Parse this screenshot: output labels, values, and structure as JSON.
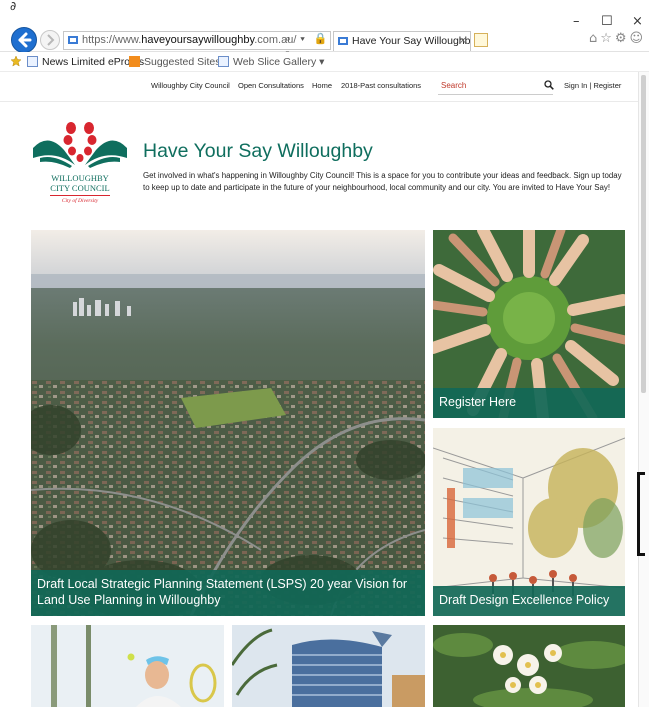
{
  "browser": {
    "stray_char": "∂",
    "url_prefix": "https://www.",
    "url_domain": "haveyoursaywilloughby",
    "url_suffix": ".com.au/",
    "tab_title": "Have Your Say Willoughby |...",
    "tab_close": "×",
    "window_controls": {
      "minimize": "–",
      "maximize": "☐",
      "close": "×"
    },
    "address_tools": "⌕ ▾ 🔒 ↻",
    "right_icons": "⌂☆⚙☺",
    "favorites": [
      {
        "label": "News Limited eProofs"
      },
      {
        "label": "Suggested Sites ▾"
      },
      {
        "label": "Web Slice Gallery ▾"
      }
    ]
  },
  "nav": {
    "links": [
      "Willoughby City Council",
      "Open Consultations",
      "Home",
      "2018-Past consultations"
    ],
    "search_placeholder": "Search",
    "sign_in": "Sign In | Register"
  },
  "header": {
    "logo_text_line1": "WILLOUGHBY",
    "logo_text_line2": "CITY COUNCIL",
    "logo_tagline": "City of Diversity",
    "title": "Have Your Say Willoughby",
    "intro": "Get involved in what's happening in Willoughby City Council! This is a space for you to contribute your ideas and feedback. Sign up today to keep up to date and participate in the future of your neighbourhood, local community and our city. You are invited to Have Your Say!"
  },
  "tiles": [
    {
      "caption": "Draft Local Strategic Planning Statement (LSPS) 20 year Vision for Land Use Planning in Willoughby"
    },
    {
      "caption": "Register Here"
    },
    {
      "caption": "Draft Design Excellence Policy"
    }
  ],
  "colors": {
    "brand_green": "#0f6e5e",
    "caption_bg": "#116857",
    "logo_red": "#d8262f",
    "search_red": "#c0392b",
    "back_blue": "#1f6fd0"
  }
}
